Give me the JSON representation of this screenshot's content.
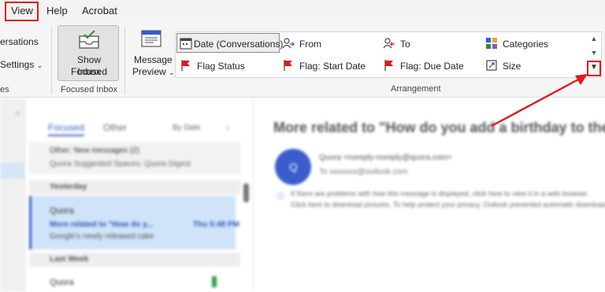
{
  "menu_tabs": [
    "View",
    "Help",
    "Acrobat"
  ],
  "ribbon": {
    "left_partial": {
      "conversations": "ersations",
      "settings": "Settings",
      "group_tail": "es"
    },
    "show_focused_inbox": {
      "line1": "Show Focused",
      "line2": "Inbox",
      "group_label": "Focused Inbox"
    },
    "message_preview": {
      "line1": "Message",
      "line2": "Preview"
    },
    "arrangement": {
      "group_label": "Arrangement",
      "items": [
        {
          "label": "Date (Conversations)",
          "icon": "calendar-icon",
          "selected": true
        },
        {
          "label": "From",
          "icon": "from-person-icon"
        },
        {
          "label": "To",
          "icon": "to-person-icon"
        },
        {
          "label": "Categories",
          "icon": "categories-icon"
        },
        {
          "label": "Flag Status",
          "icon": "flag-icon"
        },
        {
          "label": "Flag: Start Date",
          "icon": "flag-icon"
        },
        {
          "label": "Flag: Due Date",
          "icon": "flag-icon"
        },
        {
          "label": "Size",
          "icon": "size-icon"
        }
      ]
    }
  },
  "mail_list": {
    "tabs": [
      "Focused",
      "Other"
    ],
    "sort": "By Date",
    "header_item": {
      "title": "Other: New messages (2)",
      "subtitle": "Quora Suggested Spaces; Quora Digest"
    },
    "sections": [
      "Yesterday",
      "Last Week"
    ],
    "selected_message": {
      "sender": "Quora",
      "subject": "More related to \"How do y...",
      "time": "Thu 5:48 PM",
      "preview": "Google's newly released cake"
    },
    "next_sender": "Quora"
  },
  "reading_pane": {
    "subject": "More related to \"How do you add a birthday to the G",
    "from": "Quora <noreply-noreply@quora.com>",
    "to": "To  xxxxxxx@outlook.com",
    "notice_line1": "If there are problems with how this message is displayed, click here to view it in a web browser.",
    "notice_line2": "Click here to download pictures. To help protect your privacy, Outlook prevented automatic download."
  },
  "colors": {
    "highlight_red": "#e0191e",
    "accent_blue": "#3a5ccc",
    "selected_row": "#cfe4f8"
  }
}
